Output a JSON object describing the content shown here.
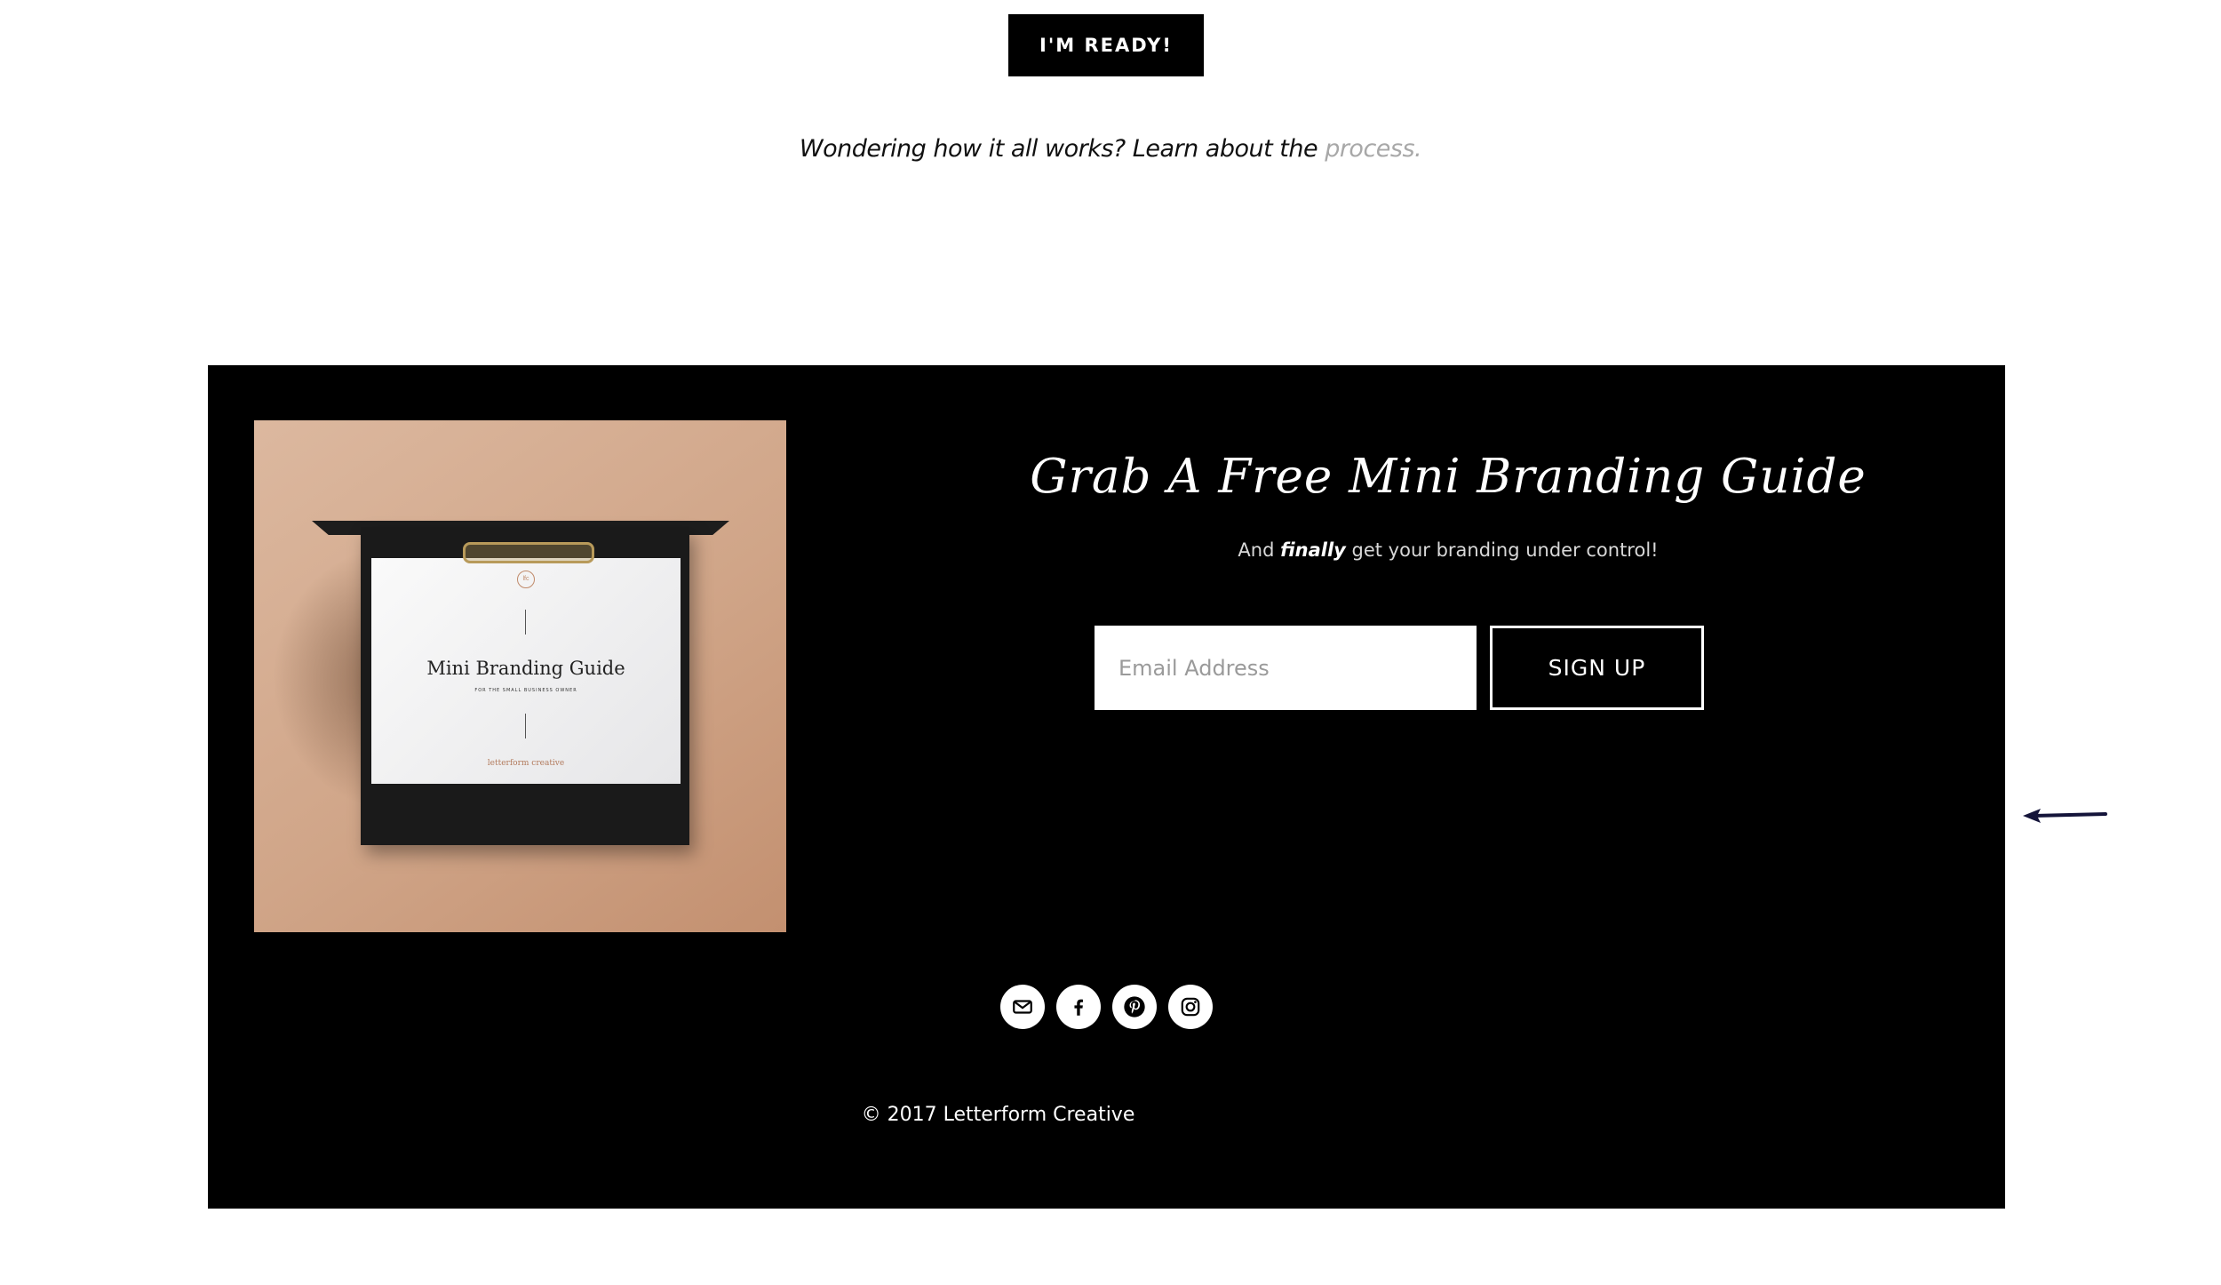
{
  "cta": {
    "label": "I'M READY!"
  },
  "process": {
    "text": "Wondering how it all works? Learn about the ",
    "link": "process."
  },
  "promo_image": {
    "title": "Mini Branding Guide",
    "subtitle": "FOR THE SMALL BUSINESS OWNER",
    "brand": "letterform creative",
    "monogram": "lfc"
  },
  "newsletter": {
    "heading": "Grab A Free Mini Branding Guide",
    "sub_before": "And ",
    "sub_emphasis": "finally",
    "sub_after": " get your branding under control!",
    "email_placeholder": "Email Address",
    "signup_label": "SIGN UP"
  },
  "social": {
    "icons": [
      "email-icon",
      "facebook-icon",
      "pinterest-icon",
      "instagram-icon"
    ]
  },
  "footer": {
    "copyright": "© 2017 Letterform Creative"
  },
  "colors": {
    "background": "#ffffff",
    "footer": "#000000",
    "link": "#a8a8a8",
    "promo": "#d0a588"
  }
}
